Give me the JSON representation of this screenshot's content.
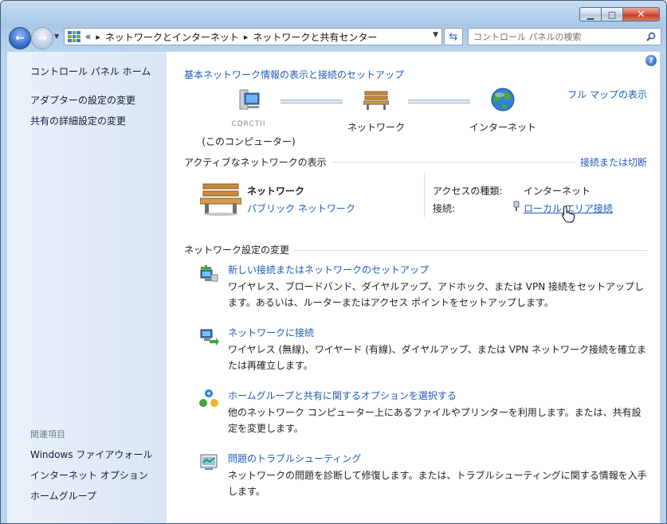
{
  "address_bar": {
    "overflow": "«",
    "crumbs": [
      "ネットワークとインターネット",
      "ネットワークと共有センター"
    ]
  },
  "search": {
    "placeholder": "コントロール パネルの検索"
  },
  "sidebar": {
    "home": "コントロール パネル ホーム",
    "links": [
      "アダプターの設定の変更",
      "共有の詳細設定の変更"
    ],
    "related_heading": "関連項目",
    "related": [
      "Windows ファイアウォール",
      "インターネット オプション",
      "ホームグループ"
    ]
  },
  "main": {
    "heading": "基本ネットワーク情報の表示と接続のセットアップ",
    "full_map": "フル マップの表示",
    "map": {
      "computer_name": "CDRCTII",
      "computer_label": "(このコンピューター)",
      "network_label": "ネットワーク",
      "internet_label": "インターネット"
    },
    "active": {
      "title": "アクティブなネットワークの表示",
      "connect_link": "接続または切断",
      "network_name": "ネットワーク",
      "network_type": "パブリック ネットワーク",
      "access_type_label": "アクセスの種類:",
      "access_type_value": "インターネット",
      "connection_label": "接続:",
      "connection_value": "ローカル エリア接続"
    },
    "change": {
      "title": "ネットワーク設定の変更",
      "tasks": [
        {
          "title": "新しい接続またはネットワークのセットアップ",
          "desc": "ワイヤレス、ブロードバンド、ダイヤルアップ、アドホック、または VPN 接続をセットアップします。あるいは、ルーターまたはアクセス ポイントをセットアップします。",
          "icon": "new-connection-icon"
        },
        {
          "title": "ネットワークに接続",
          "desc": "ワイヤレス (無線)、ワイヤード (有線)、ダイヤルアップ、または VPN ネットワーク接続を確立または再確立します。",
          "icon": "connect-network-icon"
        },
        {
          "title": "ホームグループと共有に関するオプションを選択する",
          "desc": "他のネットワーク コンピューター上にあるファイルやプリンターを利用します。または、共有設定を変更します。",
          "icon": "homegroup-icon"
        },
        {
          "title": "問題のトラブルシューティング",
          "desc": "ネットワークの問題を診断して修復します。または、トラブルシューティングに関する情報を入手します。",
          "icon": "troubleshoot-icon"
        }
      ]
    }
  },
  "colors": {
    "link": "#1e5bb8",
    "sidebar": "#e3edf8",
    "frame": "#b9d3ee"
  }
}
